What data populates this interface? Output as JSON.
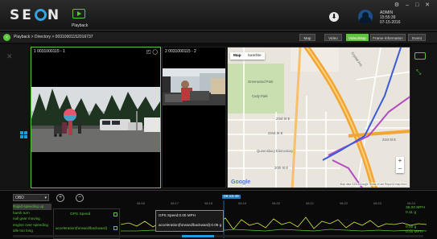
{
  "app": {
    "logo_text": "SEON",
    "nav_playback_label": "Playback",
    "user_name": "ADMIN",
    "user_time": "15:55:39",
    "user_date": "07-15-2016",
    "win_controls": "⚙ – □ ✕"
  },
  "breadcrumb": {
    "text": "Playback > Directory > 00310001152016737",
    "tabs": [
      {
        "label": "Map",
        "active": false
      },
      {
        "label": "Video",
        "active": false
      },
      {
        "label": "Video/Map",
        "active": true
      },
      {
        "label": "Frame Information",
        "active": false
      },
      {
        "label": "Event",
        "active": false
      }
    ]
  },
  "videos": {
    "cam1_label": "1  0031000115 - 1",
    "cam2_label": "2  0031000115 - 2"
  },
  "map": {
    "type_map": "Map",
    "type_satellite": "Satellite",
    "streets": {
      "s1": "Crystal Ave",
      "s2": "Cody Park",
      "s3": "23rd St E",
      "s4": "22nd St E",
      "s5": "Queensbury Elementary",
      "s6": "20th St E",
      "s7": "Meridian Ave",
      "s8": "21st St E",
      "s9": "Greenwood Park",
      "s10": "Sumner Ave"
    },
    "zoom_in": "+",
    "zoom_out": "−",
    "google": "Google",
    "terms": "Map data ©2016 Google  Terms of Use  Report a map error"
  },
  "bottom": {
    "obd_label": "OBD",
    "obd_dropdown": "▾",
    "events": [
      "Rapid speeding up",
      "harsh turn",
      "null gear moving",
      "engine over speeding",
      "idle too long"
    ],
    "gps_speed_label": "GPS Speed",
    "accel_label": "acceleration(forward/backward)",
    "time_head": "08:18:49",
    "ticks": [
      "08:16",
      "08:17",
      "08:18",
      "08:19",
      "08:20",
      "08:21",
      "08:22",
      "08:23",
      "08:24"
    ],
    "tooltip_speed": "GPS Speed:0.00 MPH",
    "tooltip_accel": "acceleration(forward/backward):0.06 g",
    "right_speed": "36.00 MPH",
    "right_g1": "0.11 g",
    "right_g2": "0.00 g",
    "right_mph2": "0.00 MPH"
  }
}
